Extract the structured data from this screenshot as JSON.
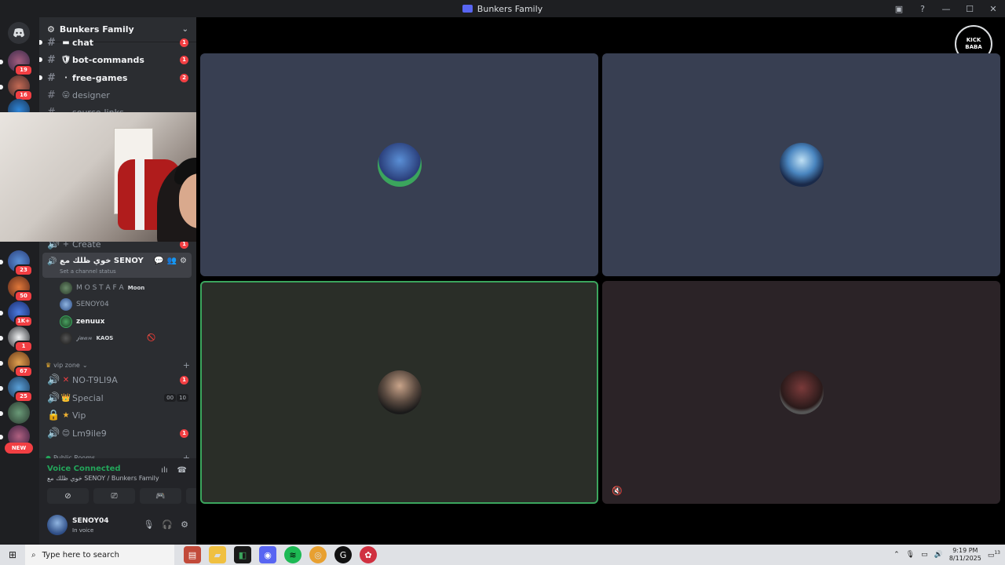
{
  "window": {
    "title": "Bunkers Family"
  },
  "watermark": {
    "line1": "KICK",
    "line2": "BABA"
  },
  "server": {
    "name": "Bunkers Family"
  },
  "channels": [
    {
      "emoji": "▬",
      "name": "chat",
      "badge": "1",
      "unread": true
    },
    {
      "emoji": "🛡",
      "name": "bot-commands",
      "badge": "1",
      "unread": true
    },
    {
      "emoji": "·",
      "name": "free-games",
      "badge": "2",
      "unread": true
    },
    {
      "emoji": "😛",
      "name": "designer",
      "badge": "",
      "unread": false
    },
    {
      "emoji": "",
      "name": "source-links",
      "badge": "",
      "unread": false
    }
  ],
  "create_channel": {
    "name": "Create",
    "badge": "1"
  },
  "active_voice": {
    "name": "خوي ظلك مع SENOY",
    "status": "Set a channel status",
    "users": [
      {
        "name": "M O S T A F A",
        "tag": "Moon"
      },
      {
        "name": "SENOY04",
        "tag": ""
      },
      {
        "name": "zenuux",
        "tag": ""
      },
      {
        "name": "𝒿𝓊𝒶𝓃",
        "tag": "KAOS"
      }
    ]
  },
  "category_vip": {
    "name": "vip zone"
  },
  "vip_channels": [
    {
      "emoji": "✕",
      "name": "NO-T9LI9A",
      "badge": "1",
      "counts": []
    },
    {
      "emoji": "👑",
      "name": "Special",
      "badge": "",
      "counts": [
        "00",
        "10"
      ]
    },
    {
      "emoji": "★",
      "name": "Vip",
      "badge": "",
      "counts": []
    },
    {
      "emoji": "😊",
      "name": "Lm9ile9",
      "badge": "1",
      "counts": []
    }
  ],
  "category_public": {
    "name": "Public Rooms"
  },
  "guild_badges": [
    "19",
    "16",
    "23",
    "50",
    "1K+",
    "1",
    "67",
    "25",
    "NEW"
  ],
  "voice_panel": {
    "status": "Voice Connected",
    "location": "خوي ظلك مع SENOY / Bunkers Family"
  },
  "user": {
    "name": "SENOY04",
    "status": "In voice"
  },
  "taskbar": {
    "search_placeholder": "Type here to search",
    "time": "9:19 PM",
    "date": "8/11/2025",
    "notifications": "13"
  },
  "colors": {
    "accent": "#5865f2",
    "danger": "#f23f43",
    "success": "#23a55a",
    "speaking": "#3ba55d"
  }
}
